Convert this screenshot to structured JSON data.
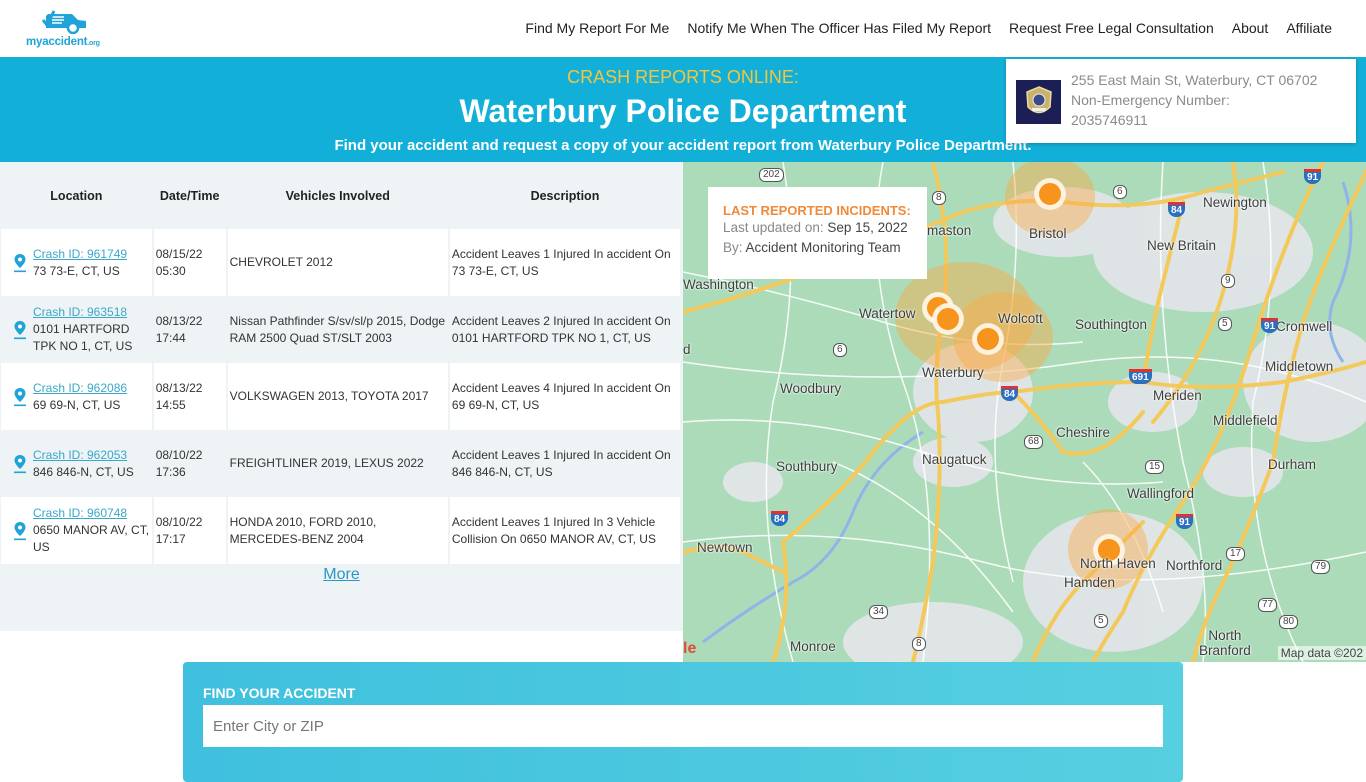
{
  "header": {
    "logo_text": "myaccident",
    "logo_suffix": ".org",
    "nav": [
      {
        "label": "Find My Report For Me"
      },
      {
        "label": "Notify Me When The Officer Has Filed My Report"
      },
      {
        "label": "Request Free Legal Consultation"
      },
      {
        "label": "About"
      },
      {
        "label": "Affiliate"
      }
    ]
  },
  "hero": {
    "kicker": "CRASH REPORTS ONLINE:",
    "title": "Waterbury Police Department",
    "subtitle": "Find your accident and request a copy of your accident report from Waterbury Police Department."
  },
  "department": {
    "badge_icon": "police-badge-icon",
    "address": "255 East Main St, Waterbury, CT 06702",
    "phone_label": "Non-Emergency Number:",
    "phone": "2035746911"
  },
  "table": {
    "headers": [
      "Location",
      "Date/Time",
      "Vehicles Involved",
      "Description"
    ],
    "rows": [
      {
        "crash_id": "Crash ID: 961749",
        "location": "73 73-E, CT, US",
        "date": "08/15/22",
        "time": "05:30",
        "vehicles": "CHEVROLET 2012",
        "description": "Accident Leaves 1 Injured In accident On 73 73-E, CT, US"
      },
      {
        "crash_id": "Crash ID: 963518",
        "location": "0101 HARTFORD TPK NO 1, CT, US",
        "date": "08/13/22",
        "time": "17:44",
        "vehicles": "Nissan Pathfinder S/sv/sl/p 2015, Dodge RAM 2500 Quad ST/SLT 2003",
        "description": "Accident Leaves 2 Injured In accident On 0101 HARTFORD TPK NO 1, CT, US"
      },
      {
        "crash_id": "Crash ID: 962086",
        "location": "69 69-N, CT, US",
        "date": "08/13/22",
        "time": "14:55",
        "vehicles": "VOLKSWAGEN 2013, TOYOTA 2017",
        "description": "Accident Leaves 4 Injured In accident On 69 69-N, CT, US"
      },
      {
        "crash_id": "Crash ID: 962053",
        "location": "846 846-N, CT, US",
        "date": "08/10/22",
        "time": "17:36",
        "vehicles": "FREIGHTLINER 2019, LEXUS 2022",
        "description": "Accident Leaves 1 Injured In accident On 846 846-N, CT, US"
      },
      {
        "crash_id": "Crash ID: 960748",
        "location": "0650 MANOR AV, CT, US",
        "date": "08/10/22",
        "time": "17:17",
        "vehicles": "HONDA 2010, FORD 2010, MERCEDES-BENZ 2004",
        "description": "Accident Leaves 1 Injured In 3 Vehicle Collision On 0650 MANOR AV, CT, US"
      }
    ],
    "more_label": "More"
  },
  "map": {
    "incidents_title": "LAST REPORTED INCIDENTS:",
    "updated_label": "Last updated on:",
    "updated_value": "Sep 15, 2022",
    "by_label": "By:",
    "by_value": "Accident Monitoring Team",
    "attribution": "Map data ©202",
    "google_fragment": "le",
    "places": [
      "Bristol",
      "Newington",
      "New Britain",
      "Washington",
      "Thomaston",
      "Watertown",
      "Wolcott",
      "Southington",
      "Cromwell",
      "Middletown",
      "Woodbury",
      "Waterbury",
      "Meriden",
      "Cheshire",
      "Middlefield",
      "Southbury",
      "Naugatuck",
      "Durham",
      "Wallingford",
      "Newtown",
      "North Haven",
      "Northford",
      "Hamden",
      "North Branford",
      "Monroe"
    ],
    "route_shields": [
      "202",
      "8",
      "6",
      "6",
      "9",
      "5",
      "68",
      "15",
      "17",
      "79",
      "77",
      "80",
      "34",
      "8",
      "5"
    ],
    "interstate_shields": [
      "91",
      "84",
      "91",
      "691",
      "84",
      "84",
      "91"
    ]
  },
  "find": {
    "label": "FIND YOUR ACCIDENT",
    "placeholder": "Enter City or ZIP",
    "value": ""
  }
}
